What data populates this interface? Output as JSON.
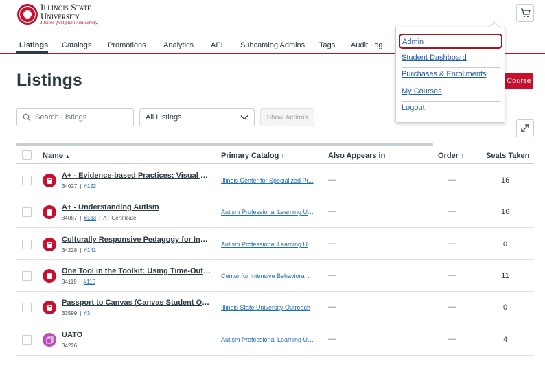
{
  "brand": {
    "line1": "Illinois State",
    "line2": "University",
    "tagline": "Illinois' first public university."
  },
  "cart": {
    "icon": "cart-icon"
  },
  "tabs": [
    {
      "label": "Listings",
      "active": true
    },
    {
      "label": "Catalogs"
    },
    {
      "label": "Promotions"
    },
    {
      "label": "Analytics"
    },
    {
      "label": "API"
    },
    {
      "label": "Subcatalog Admins"
    },
    {
      "label": "Tags"
    },
    {
      "label": "Audit Log"
    }
  ],
  "page": {
    "title": "Listings",
    "add_button_label": "Course"
  },
  "toolbar": {
    "search_placeholder": "Search Listings",
    "filter_value": "All Listings",
    "actions_label": "Show Actions"
  },
  "table": {
    "columns": {
      "name": "Name",
      "catalog": "Primary Catalog",
      "also": "Also Appears in",
      "order": "Order",
      "seats": "Seats Taken"
    },
    "rows": [
      {
        "title": "A+ - Evidence-based Practices: Visual Sched ...",
        "id": "34027",
        "ref": "#122",
        "extra": "",
        "catalog": "Illinois Center for Specialized Pr...",
        "also": "—",
        "order": "—",
        "seats": "16",
        "icon": "course-icon",
        "icon_color": "#c8102e"
      },
      {
        "title": "A+ - Understanding Autism",
        "id": "34087",
        "ref": "#133",
        "extra": "A+ Certificate",
        "catalog": "Autism Professional Learning Un ...",
        "also": "—",
        "order": "—",
        "seats": "16",
        "icon": "course-icon",
        "icon_color": "#c8102e"
      },
      {
        "title": "Culturally Responsive Pedagogy for Individ ...",
        "id": "34228",
        "ref": "#141",
        "extra": "",
        "catalog": "Autism Professional Learning Un ...",
        "also": "—",
        "order": "—",
        "seats": "0",
        "icon": "course-icon",
        "icon_color": "#c8102e"
      },
      {
        "title": "One Tool in the Toolkit: Using Time-Out Effe ...",
        "id": "34119",
        "ref": "#116",
        "extra": "",
        "catalog": "Center for Intensive Behavioral ...",
        "also": "—",
        "order": "—",
        "seats": "11",
        "icon": "course-icon",
        "icon_color": "#c8102e"
      },
      {
        "title": "Passport to Canvas (Canvas Student Orient ...",
        "id": "33599",
        "ref": "#3",
        "extra": "",
        "catalog": "Illinois State University Outreach",
        "also": "—",
        "order": "—",
        "seats": "0",
        "icon": "course-icon",
        "icon_color": "#c8102e"
      },
      {
        "title": "UATO",
        "id": "34226",
        "ref": "",
        "extra": "",
        "catalog": "Autism Professional Learning Un ...",
        "also": "—",
        "order": "—",
        "seats": "4",
        "icon": "program-icon",
        "icon_color": "#b84fb9"
      }
    ]
  },
  "menu": {
    "items": [
      {
        "label": "Admin",
        "focused": true
      },
      {
        "label": "Student Dashboard"
      },
      {
        "label": "Purchases & Enrollments"
      },
      {
        "label": "My Courses"
      },
      {
        "label": "Logout"
      }
    ]
  },
  "colors": {
    "brand_red": "#c8102e",
    "link_blue": "#1f6fb5",
    "text": "#2d3b45"
  }
}
